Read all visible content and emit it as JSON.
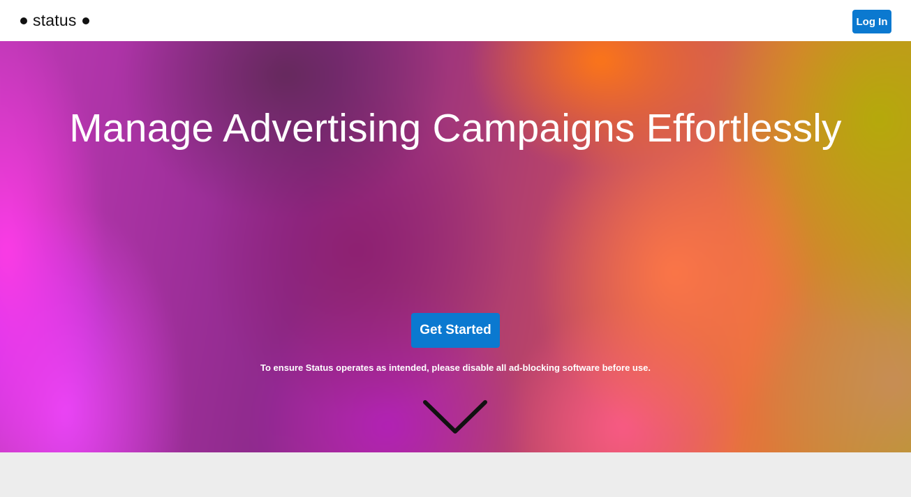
{
  "navbar": {
    "brand": "status",
    "login_label": "Log In"
  },
  "hero": {
    "title": "Manage Advertising Campaigns Effortlessly",
    "cta_label": "Get Started",
    "notice": "To ensure Status operates as intended, please disable all ad-blocking software before use.",
    "scroll_icon": "chevron-down-icon"
  },
  "colors": {
    "accent": "#0b79d0",
    "navbar_bg": "#ffffff",
    "footer_bg": "#ededed",
    "text_light": "#ffffff"
  }
}
